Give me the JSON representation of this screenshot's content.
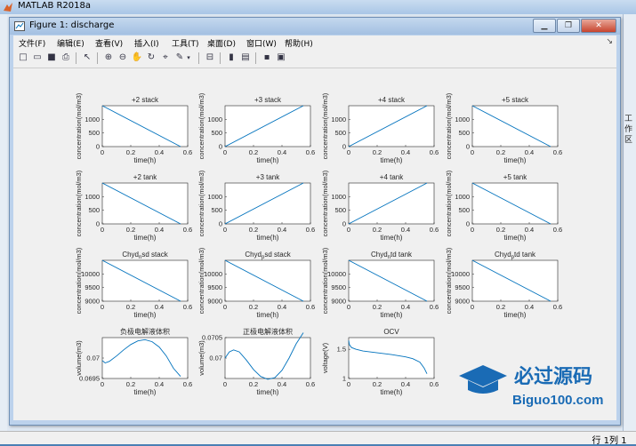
{
  "app": {
    "title": "MATLAB R2018a"
  },
  "figure": {
    "title": "Figure 1: discharge",
    "menus": [
      "文件(F)",
      "编辑(E)",
      "查看(V)",
      "插入(I)",
      "工具(T)",
      "桌面(D)",
      "窗口(W)",
      "帮助(H)"
    ],
    "toolbar_icons": [
      "new-figure-icon",
      "open-icon",
      "save-icon",
      "print-icon",
      "pointer-icon",
      "zoom-in-icon",
      "zoom-out-icon",
      "pan-icon",
      "rotate-icon",
      "data-cursor-icon",
      "brush-icon",
      "colorbar-icon",
      "legend-icon",
      "hide-plot-tools-icon",
      "show-plot-tools-icon"
    ]
  },
  "side_panel": {
    "label1": "工",
    "label2": "作",
    "label3": "区"
  },
  "status": {
    "row_label": "行",
    "row_value": "1",
    "col_label": "列",
    "col_value": "1"
  },
  "watermark": {
    "text1": "必过源码",
    "text2": "Biguo100.com"
  },
  "colors": {
    "line": "#0072bd"
  },
  "chart_data": [
    {
      "type": "line",
      "title": "+2 stack",
      "xlabel": "time(h)",
      "ylabel": "concentration(mol/m3)",
      "xlim": [
        0,
        0.6
      ],
      "ylim": [
        0,
        1500
      ],
      "xticks": [
        "0",
        "0.2",
        "0.4",
        "0.6"
      ],
      "yticks": [
        "0",
        "500",
        "1000"
      ],
      "x": [
        0,
        0.55
      ],
      "y": [
        1500,
        0
      ]
    },
    {
      "type": "line",
      "title": "+3 stack",
      "xlabel": "time(h)",
      "ylabel": "concentration(mol/m3)",
      "xlim": [
        0,
        0.6
      ],
      "ylim": [
        0,
        1500
      ],
      "xticks": [
        "0",
        "0.2",
        "0.4",
        "0.6"
      ],
      "yticks": [
        "0",
        "500",
        "1000"
      ],
      "x": [
        0,
        0.55
      ],
      "y": [
        0,
        1500
      ]
    },
    {
      "type": "line",
      "title": "+4 stack",
      "xlabel": "time(h)",
      "ylabel": "concentration(mol/m3)",
      "xlim": [
        0,
        0.6
      ],
      "ylim": [
        0,
        1500
      ],
      "xticks": [
        "0",
        "0.2",
        "0.4",
        "0.6"
      ],
      "yticks": [
        "0",
        "500",
        "1000"
      ],
      "x": [
        0,
        0.55
      ],
      "y": [
        0,
        1500
      ]
    },
    {
      "type": "line",
      "title": "+5 stack",
      "xlabel": "time(h)",
      "ylabel": "concentration(mol/m3)",
      "xlim": [
        0,
        0.6
      ],
      "ylim": [
        0,
        1500
      ],
      "xticks": [
        "0",
        "0.2",
        "0.4",
        "0.6"
      ],
      "yticks": [
        "0",
        "500",
        "1000"
      ],
      "x": [
        0,
        0.55
      ],
      "y": [
        1500,
        0
      ]
    },
    {
      "type": "line",
      "title": "+2 tank",
      "xlabel": "time(h)",
      "ylabel": "concentration(mol/m3)",
      "xlim": [
        0,
        0.6
      ],
      "ylim": [
        0,
        1500
      ],
      "xticks": [
        "0",
        "0.2",
        "0.4",
        "0.6"
      ],
      "yticks": [
        "0",
        "500",
        "1000"
      ],
      "x": [
        0,
        0.55
      ],
      "y": [
        1500,
        0
      ]
    },
    {
      "type": "line",
      "title": "+3 tank",
      "xlabel": "time(h)",
      "ylabel": "concentration(mol/m3)",
      "xlim": [
        0,
        0.6
      ],
      "ylim": [
        0,
        1500
      ],
      "xticks": [
        "0",
        "0.2",
        "0.4",
        "0.6"
      ],
      "yticks": [
        "0",
        "500",
        "1000"
      ],
      "x": [
        0,
        0.55
      ],
      "y": [
        0,
        1500
      ]
    },
    {
      "type": "line",
      "title": "+4 tank",
      "xlabel": "time(h)",
      "ylabel": "concentration(mol/m3)",
      "xlim": [
        0,
        0.6
      ],
      "ylim": [
        0,
        1500
      ],
      "xticks": [
        "0",
        "0.2",
        "0.4",
        "0.6"
      ],
      "yticks": [
        "0",
        "500",
        "1000"
      ],
      "x": [
        0,
        0.55
      ],
      "y": [
        0,
        1500
      ]
    },
    {
      "type": "line",
      "title": "+5 tank",
      "xlabel": "time(h)",
      "ylabel": "concentration(mol/m3)",
      "xlim": [
        0,
        0.6
      ],
      "ylim": [
        0,
        1500
      ],
      "xticks": [
        "0",
        "0.2",
        "0.4",
        "0.6"
      ],
      "yticks": [
        "0",
        "500",
        "1000"
      ],
      "x": [
        0,
        0.55
      ],
      "y": [
        1500,
        0
      ]
    },
    {
      "type": "line",
      "title": "Chyd",
      "title_sub": "n",
      "title_rest": "sd stack",
      "xlabel": "time(h)",
      "ylabel": "concentration(mol/m3)",
      "xlim": [
        0,
        0.6
      ],
      "ylim": [
        9000,
        10500
      ],
      "xticks": [
        "0",
        "0.2",
        "0.4",
        "0.6"
      ],
      "yticks": [
        "9000",
        "9500",
        "10000"
      ],
      "x": [
        0,
        0.55
      ],
      "y": [
        10500,
        9000
      ]
    },
    {
      "type": "line",
      "title": "Chyd",
      "title_sub": "p",
      "title_rest": "sd stack",
      "xlabel": "time(h)",
      "ylabel": "concentration(mol/m3)",
      "xlim": [
        0,
        0.6
      ],
      "ylim": [
        9000,
        10500
      ],
      "xticks": [
        "0",
        "0.2",
        "0.4",
        "0.6"
      ],
      "yticks": [
        "9000",
        "9500",
        "10000"
      ],
      "x": [
        0,
        0.55
      ],
      "y": [
        10500,
        9000
      ]
    },
    {
      "type": "line",
      "title": "Chyd",
      "title_sub": "n",
      "title_rest": "td tank",
      "xlabel": "time(h)",
      "ylabel": "concentration(mol/m3)",
      "xlim": [
        0,
        0.6
      ],
      "ylim": [
        9000,
        10500
      ],
      "xticks": [
        "0",
        "0.2",
        "0.4",
        "0.6"
      ],
      "yticks": [
        "9000",
        "9500",
        "10000"
      ],
      "x": [
        0,
        0.55
      ],
      "y": [
        10500,
        9000
      ]
    },
    {
      "type": "line",
      "title": "Chyd",
      "title_sub": "p",
      "title_rest": "td tank",
      "xlabel": "time(h)",
      "ylabel": "concentration(mol/m3)",
      "xlim": [
        0,
        0.6
      ],
      "ylim": [
        9000,
        10500
      ],
      "xticks": [
        "0",
        "0.2",
        "0.4",
        "0.6"
      ],
      "yticks": [
        "9000",
        "9500",
        "10000"
      ],
      "x": [
        0,
        0.55
      ],
      "y": [
        10500,
        9000
      ]
    },
    {
      "type": "line",
      "title": "负极电解液体积",
      "xlabel": "time(h)",
      "ylabel": "volume(m3)",
      "xlim": [
        0,
        0.6
      ],
      "ylim": [
        0.0695,
        0.0705
      ],
      "xticks": [
        "0",
        "0.2",
        "0.4",
        "0.6"
      ],
      "yticks": [
        "0.0695",
        "0.07"
      ],
      "x": [
        0,
        0.02,
        0.05,
        0.1,
        0.15,
        0.2,
        0.25,
        0.3,
        0.35,
        0.4,
        0.45,
        0.5,
        0.55
      ],
      "y": [
        0.06994,
        0.06988,
        0.06992,
        0.07005,
        0.0702,
        0.07033,
        0.07042,
        0.07045,
        0.0704,
        0.07027,
        0.07005,
        0.06975,
        0.06955
      ]
    },
    {
      "type": "line",
      "title": "正极电解液体积",
      "xlabel": "time(h)",
      "ylabel": "volume(m3)",
      "xlim": [
        0,
        0.6
      ],
      "ylim": [
        0.0695,
        0.0705
      ],
      "xticks": [
        "0",
        "0.2",
        "0.4",
        "0.6"
      ],
      "yticks": [
        "0.07",
        "0.0705"
      ],
      "x": [
        0,
        0.03,
        0.06,
        0.1,
        0.15,
        0.2,
        0.25,
        0.3,
        0.35,
        0.4,
        0.45,
        0.5,
        0.55
      ],
      "y": [
        0.07,
        0.07015,
        0.0702,
        0.07015,
        0.06995,
        0.06972,
        0.06955,
        0.06948,
        0.06952,
        0.0697,
        0.07,
        0.07035,
        0.07062
      ]
    },
    {
      "type": "line",
      "title": "OCV",
      "xlabel": "time(h)",
      "ylabel": "voltage(V)",
      "xlim": [
        0,
        0.6
      ],
      "ylim": [
        1,
        1.7
      ],
      "xticks": [
        "0",
        "0.2",
        "0.4",
        "0.6"
      ],
      "yticks": [
        "1",
        "1.5"
      ],
      "x": [
        0,
        0.005,
        0.02,
        0.05,
        0.1,
        0.2,
        0.3,
        0.4,
        0.45,
        0.5,
        0.53,
        0.55
      ],
      "y": [
        1.65,
        1.58,
        1.53,
        1.5,
        1.47,
        1.44,
        1.41,
        1.37,
        1.34,
        1.28,
        1.18,
        1.08
      ]
    }
  ]
}
